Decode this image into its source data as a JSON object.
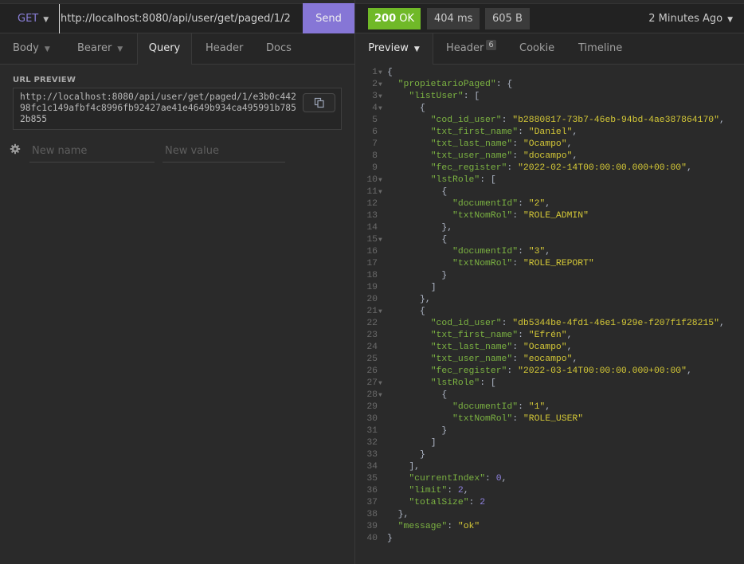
{
  "request": {
    "method": "GET",
    "url": "http://localhost:8080/api/user/get/paged/1/2",
    "send_label": "Send",
    "tabs": [
      {
        "label": "Body",
        "has_dropdown": true
      },
      {
        "label": "Bearer",
        "has_dropdown": true
      },
      {
        "label": "Query",
        "active": true
      },
      {
        "label": "Header"
      },
      {
        "label": "Docs"
      }
    ],
    "url_preview_label": "URL PREVIEW",
    "url_preview": "http://localhost:8080/api/user/get/paged/1/e3b0c44298fc1c149afbf4c8996fb92427ae41e4649b934ca495991b7852b855",
    "params": {
      "name_placeholder": "New name",
      "value_placeholder": "New value"
    }
  },
  "response": {
    "status_code": "200",
    "status_text": "OK",
    "time": "404 ms",
    "size": "605 B",
    "time_ago": "2 Minutes Ago",
    "tabs": [
      {
        "label": "Preview",
        "active": true,
        "has_dropdown": true
      },
      {
        "label": "Header",
        "count": "6"
      },
      {
        "label": "Cookie"
      },
      {
        "label": "Timeline"
      }
    ],
    "colors": {
      "status_ok": "#70b928",
      "send_button": "#8676d6",
      "json_key": "#7cb342",
      "json_string": "#d4c837",
      "json_number": "#8f82e0"
    },
    "code_lines": [
      {
        "n": "1",
        "fold": true,
        "indent": 0,
        "parts": [
          [
            "p",
            "{"
          ]
        ]
      },
      {
        "n": "2",
        "fold": true,
        "indent": 1,
        "parts": [
          [
            "k",
            "\"propietarioPaged\""
          ],
          [
            "p",
            ": {"
          ]
        ]
      },
      {
        "n": "3",
        "fold": true,
        "indent": 2,
        "parts": [
          [
            "k",
            "\"listUser\""
          ],
          [
            "p",
            ": ["
          ]
        ]
      },
      {
        "n": "4",
        "fold": true,
        "indent": 3,
        "parts": [
          [
            "p",
            "{"
          ]
        ]
      },
      {
        "n": "5",
        "indent": 4,
        "parts": [
          [
            "k",
            "\"cod_id_user\""
          ],
          [
            "p",
            ": "
          ],
          [
            "s",
            "\"b2880817-73b7-46eb-94bd-4ae387864170\""
          ],
          [
            "p",
            ","
          ]
        ]
      },
      {
        "n": "6",
        "indent": 4,
        "parts": [
          [
            "k",
            "\"txt_first_name\""
          ],
          [
            "p",
            ": "
          ],
          [
            "s",
            "\"Daniel\""
          ],
          [
            "p",
            ","
          ]
        ]
      },
      {
        "n": "7",
        "indent": 4,
        "parts": [
          [
            "k",
            "\"txt_last_name\""
          ],
          [
            "p",
            ": "
          ],
          [
            "s",
            "\"Ocampo\""
          ],
          [
            "p",
            ","
          ]
        ]
      },
      {
        "n": "8",
        "indent": 4,
        "parts": [
          [
            "k",
            "\"txt_user_name\""
          ],
          [
            "p",
            ": "
          ],
          [
            "s",
            "\"docampo\""
          ],
          [
            "p",
            ","
          ]
        ]
      },
      {
        "n": "9",
        "indent": 4,
        "parts": [
          [
            "k",
            "\"fec_register\""
          ],
          [
            "p",
            ": "
          ],
          [
            "s",
            "\"2022-02-14T00:00:00.000+00:00\""
          ],
          [
            "p",
            ","
          ]
        ]
      },
      {
        "n": "10",
        "fold": true,
        "indent": 4,
        "parts": [
          [
            "k",
            "\"lstRole\""
          ],
          [
            "p",
            ": ["
          ]
        ]
      },
      {
        "n": "11",
        "fold": true,
        "indent": 5,
        "parts": [
          [
            "p",
            "{"
          ]
        ]
      },
      {
        "n": "12",
        "indent": 6,
        "parts": [
          [
            "k",
            "\"documentId\""
          ],
          [
            "p",
            ": "
          ],
          [
            "s",
            "\"2\""
          ],
          [
            "p",
            ","
          ]
        ]
      },
      {
        "n": "13",
        "indent": 6,
        "parts": [
          [
            "k",
            "\"txtNomRol\""
          ],
          [
            "p",
            ": "
          ],
          [
            "s",
            "\"ROLE_ADMIN\""
          ]
        ]
      },
      {
        "n": "14",
        "indent": 5,
        "parts": [
          [
            "p",
            "},"
          ]
        ]
      },
      {
        "n": "15",
        "fold": true,
        "indent": 5,
        "parts": [
          [
            "p",
            "{"
          ]
        ]
      },
      {
        "n": "16",
        "indent": 6,
        "parts": [
          [
            "k",
            "\"documentId\""
          ],
          [
            "p",
            ": "
          ],
          [
            "s",
            "\"3\""
          ],
          [
            "p",
            ","
          ]
        ]
      },
      {
        "n": "17",
        "indent": 6,
        "parts": [
          [
            "k",
            "\"txtNomRol\""
          ],
          [
            "p",
            ": "
          ],
          [
            "s",
            "\"ROLE_REPORT\""
          ]
        ]
      },
      {
        "n": "18",
        "indent": 5,
        "parts": [
          [
            "p",
            "}"
          ]
        ]
      },
      {
        "n": "19",
        "indent": 4,
        "parts": [
          [
            "p",
            "]"
          ]
        ]
      },
      {
        "n": "20",
        "indent": 3,
        "parts": [
          [
            "p",
            "},"
          ]
        ]
      },
      {
        "n": "21",
        "fold": true,
        "indent": 3,
        "parts": [
          [
            "p",
            "{"
          ]
        ]
      },
      {
        "n": "22",
        "indent": 4,
        "parts": [
          [
            "k",
            "\"cod_id_user\""
          ],
          [
            "p",
            ": "
          ],
          [
            "s",
            "\"db5344be-4fd1-46e1-929e-f207f1f28215\""
          ],
          [
            "p",
            ","
          ]
        ]
      },
      {
        "n": "23",
        "indent": 4,
        "parts": [
          [
            "k",
            "\"txt_first_name\""
          ],
          [
            "p",
            ": "
          ],
          [
            "s",
            "\"Efrén\""
          ],
          [
            "p",
            ","
          ]
        ]
      },
      {
        "n": "24",
        "indent": 4,
        "parts": [
          [
            "k",
            "\"txt_last_name\""
          ],
          [
            "p",
            ": "
          ],
          [
            "s",
            "\"Ocampo\""
          ],
          [
            "p",
            ","
          ]
        ]
      },
      {
        "n": "25",
        "indent": 4,
        "parts": [
          [
            "k",
            "\"txt_user_name\""
          ],
          [
            "p",
            ": "
          ],
          [
            "s",
            "\"eocampo\""
          ],
          [
            "p",
            ","
          ]
        ]
      },
      {
        "n": "26",
        "indent": 4,
        "parts": [
          [
            "k",
            "\"fec_register\""
          ],
          [
            "p",
            ": "
          ],
          [
            "s",
            "\"2022-03-14T00:00:00.000+00:00\""
          ],
          [
            "p",
            ","
          ]
        ]
      },
      {
        "n": "27",
        "fold": true,
        "indent": 4,
        "parts": [
          [
            "k",
            "\"lstRole\""
          ],
          [
            "p",
            ": ["
          ]
        ]
      },
      {
        "n": "28",
        "fold": true,
        "indent": 5,
        "parts": [
          [
            "p",
            "{"
          ]
        ]
      },
      {
        "n": "29",
        "indent": 6,
        "parts": [
          [
            "k",
            "\"documentId\""
          ],
          [
            "p",
            ": "
          ],
          [
            "s",
            "\"1\""
          ],
          [
            "p",
            ","
          ]
        ]
      },
      {
        "n": "30",
        "indent": 6,
        "parts": [
          [
            "k",
            "\"txtNomRol\""
          ],
          [
            "p",
            ": "
          ],
          [
            "s",
            "\"ROLE_USER\""
          ]
        ]
      },
      {
        "n": "31",
        "indent": 5,
        "parts": [
          [
            "p",
            "}"
          ]
        ]
      },
      {
        "n": "32",
        "indent": 4,
        "parts": [
          [
            "p",
            "]"
          ]
        ]
      },
      {
        "n": "33",
        "indent": 3,
        "parts": [
          [
            "p",
            "}"
          ]
        ]
      },
      {
        "n": "34",
        "indent": 2,
        "parts": [
          [
            "p",
            "],"
          ]
        ]
      },
      {
        "n": "35",
        "indent": 2,
        "parts": [
          [
            "k",
            "\"currentIndex\""
          ],
          [
            "p",
            ": "
          ],
          [
            "n",
            "0"
          ],
          [
            "p",
            ","
          ]
        ]
      },
      {
        "n": "36",
        "indent": 2,
        "parts": [
          [
            "k",
            "\"limit\""
          ],
          [
            "p",
            ": "
          ],
          [
            "n",
            "2"
          ],
          [
            "p",
            ","
          ]
        ]
      },
      {
        "n": "37",
        "indent": 2,
        "parts": [
          [
            "k",
            "\"totalSize\""
          ],
          [
            "p",
            ": "
          ],
          [
            "n",
            "2"
          ]
        ]
      },
      {
        "n": "38",
        "indent": 1,
        "parts": [
          [
            "p",
            "},"
          ]
        ]
      },
      {
        "n": "39",
        "indent": 1,
        "parts": [
          [
            "k",
            "\"message\""
          ],
          [
            "p",
            ": "
          ],
          [
            "s",
            "\"ok\""
          ]
        ]
      },
      {
        "n": "40",
        "indent": 0,
        "parts": [
          [
            "p",
            "}"
          ]
        ]
      }
    ]
  }
}
